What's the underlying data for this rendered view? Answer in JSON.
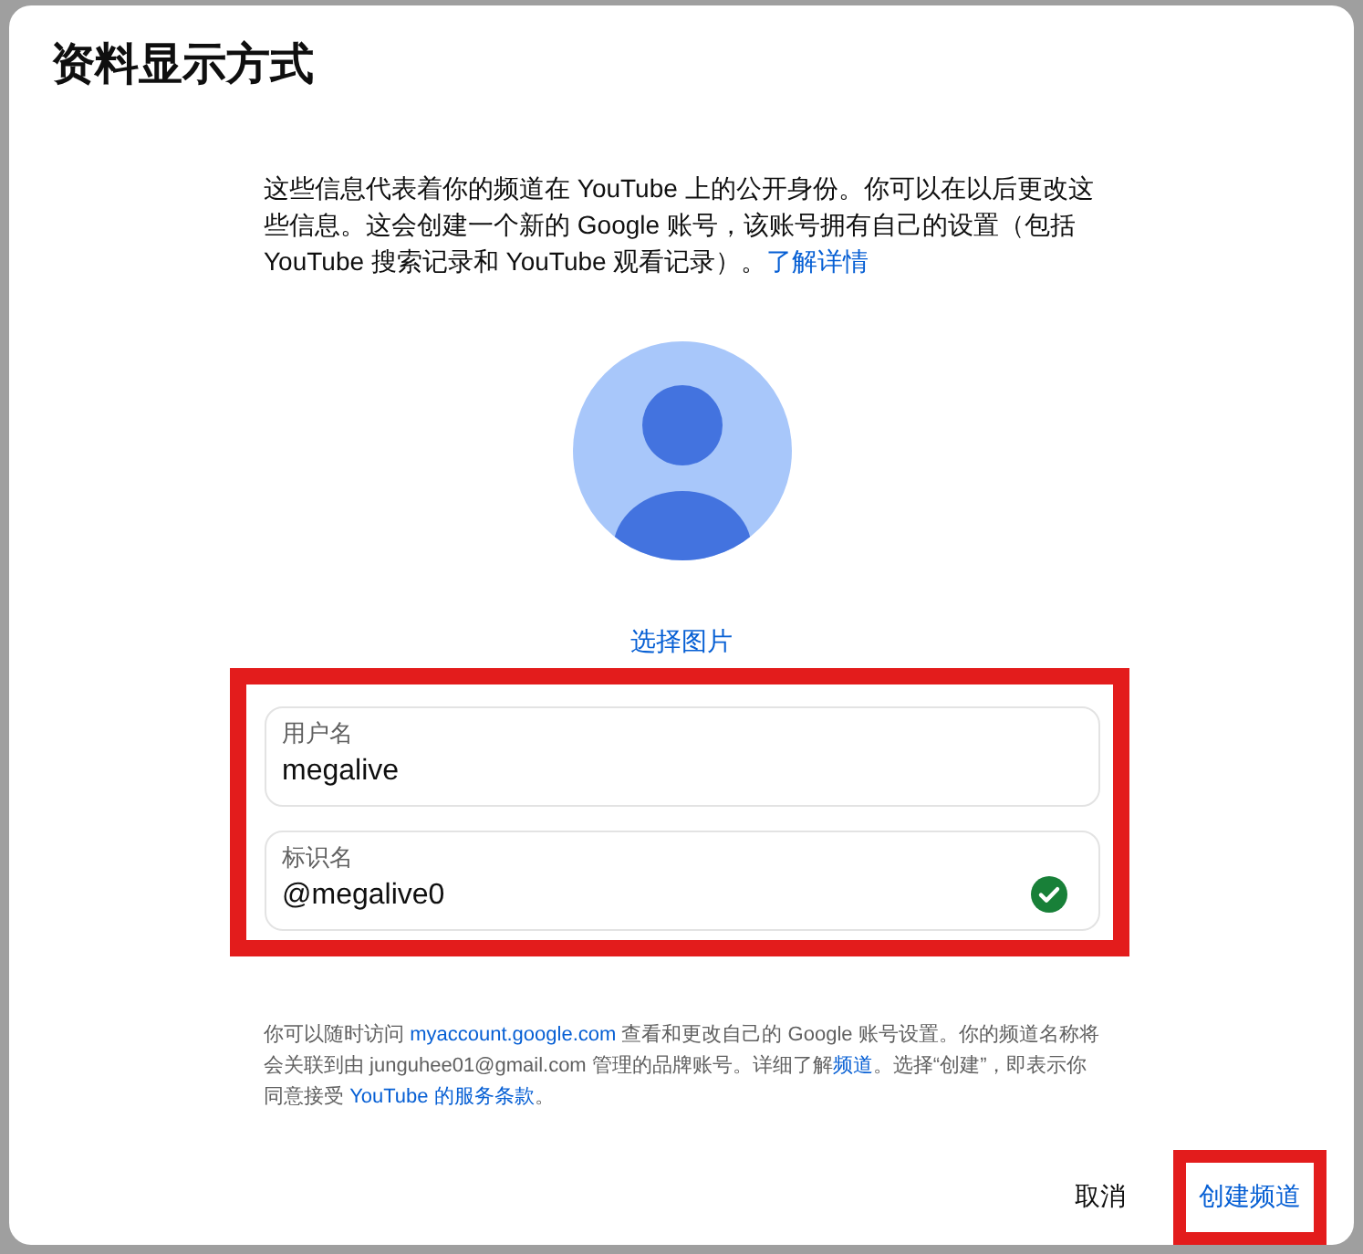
{
  "dialog": {
    "title": "资料显示方式"
  },
  "intro": {
    "text": "这些信息代表着你的频道在 YouTube 上的公开身份。你可以在以后更改这些信息。这会创建一个新的 Google 账号，该账号拥有自己的设置（包括 YouTube 搜索记录和 YouTube 观看记录）。",
    "link": "了解详情"
  },
  "avatar": {
    "link": "选择图片"
  },
  "form": {
    "highlighted": true,
    "fields": [
      {
        "label": "用户名",
        "value": "megalive",
        "valid": false
      },
      {
        "label": "标识名",
        "value": "@megalive0",
        "valid": true
      }
    ]
  },
  "footer": {
    "parts": [
      {
        "kind": "text",
        "text": "你可以随时访问 "
      },
      {
        "kind": "link",
        "text": "myaccount.google.com"
      },
      {
        "kind": "text",
        "text": " 查看和更改自己的 Google 账号设置。你的频道名称将会关联到由 junguhee01@gmail.com 管理的品牌账号。详细了解"
      },
      {
        "kind": "link",
        "text": "频道"
      },
      {
        "kind": "text",
        "text": "。选择“创建”，即表示你同意接受 "
      },
      {
        "kind": "link",
        "text": "YouTube 的服务条款"
      },
      {
        "kind": "text",
        "text": "。"
      }
    ]
  },
  "buttons": [
    {
      "label": "取消",
      "kind": "plain",
      "highlighted": false
    },
    {
      "label": "创建频道",
      "kind": "primary",
      "highlighted": true
    }
  ]
}
